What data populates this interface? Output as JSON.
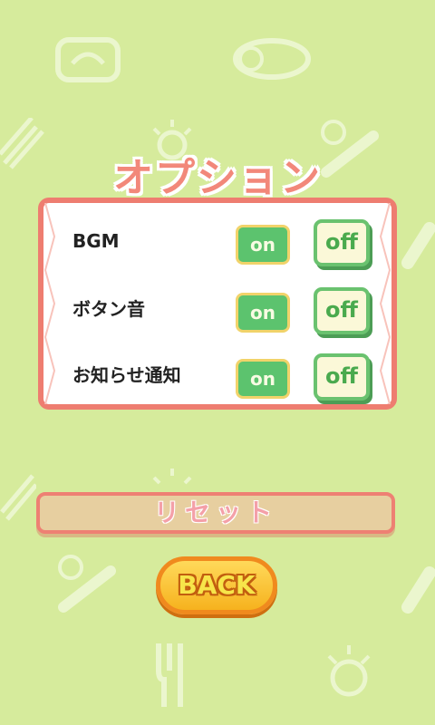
{
  "screen": {
    "title": "オプション",
    "colors": {
      "background": "#d6eb9c",
      "title": "#f2887a",
      "panel_border": "#ee7d70",
      "on_button": "#5cc36e",
      "off_button_border": "#6ac26f",
      "back_button": "#f6b21e"
    }
  },
  "settings": [
    {
      "label": "BGM",
      "on_label": "on",
      "off_label": "off"
    },
    {
      "label": "ボタン音",
      "on_label": "on",
      "off_label": "off"
    },
    {
      "label": "お知らせ通知",
      "on_label": "on",
      "off_label": "off"
    }
  ],
  "reset_label": "リセット",
  "back_label": "BACK",
  "decorations": [
    "scale-icon",
    "smiley-icon",
    "spring-icon",
    "lightbulb-icon",
    "baseball-bat-icon",
    "bottle-icon",
    "cutlery-icon"
  ]
}
